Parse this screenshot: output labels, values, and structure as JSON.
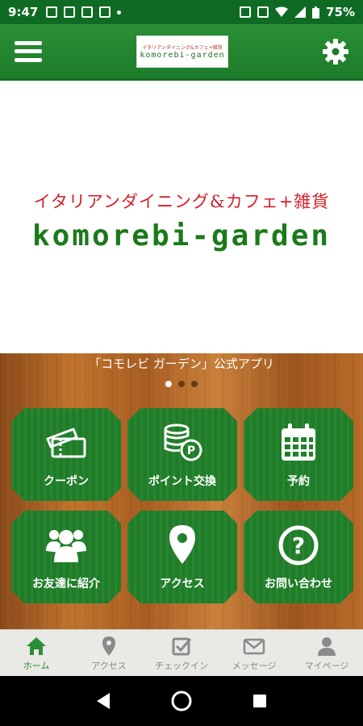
{
  "status_bar": {
    "time": "9:47",
    "battery": "75%"
  },
  "header": {
    "logo_sub": "イタリアンダイニング&カフェ+雑貨",
    "logo_main": "komorebi-garden"
  },
  "hero": {
    "subtitle": "イタリアンダイニング&カフェ+雑貨",
    "brand": "komorebi-garden"
  },
  "banner": {
    "caption": "「コモレビ ガーデン」公式アプリ",
    "slides": 3,
    "active_slide": 0
  },
  "tiles": [
    {
      "label": "クーポン",
      "icon": "ticket-icon"
    },
    {
      "label": "ポイント交換",
      "icon": "coins-icon"
    },
    {
      "label": "予約",
      "icon": "calendar-icon"
    },
    {
      "label": "お友達に紹介",
      "icon": "users-icon"
    },
    {
      "label": "アクセス",
      "icon": "map-pin-icon"
    },
    {
      "label": "お問い合わせ",
      "icon": "question-icon"
    }
  ],
  "bottom_nav": [
    {
      "label": "ホーム",
      "icon": "home-icon",
      "active": true
    },
    {
      "label": "アクセス",
      "icon": "map-pin-icon",
      "active": false
    },
    {
      "label": "チェックイン",
      "icon": "checkbox-icon",
      "active": false
    },
    {
      "label": "メッセージ",
      "icon": "envelope-icon",
      "active": false
    },
    {
      "label": "マイページ",
      "icon": "user-icon",
      "active": false
    }
  ],
  "colors": {
    "brand_green": "#1f7d28",
    "accent_red": "#d4202a",
    "active_nav": "#2a8f35"
  }
}
